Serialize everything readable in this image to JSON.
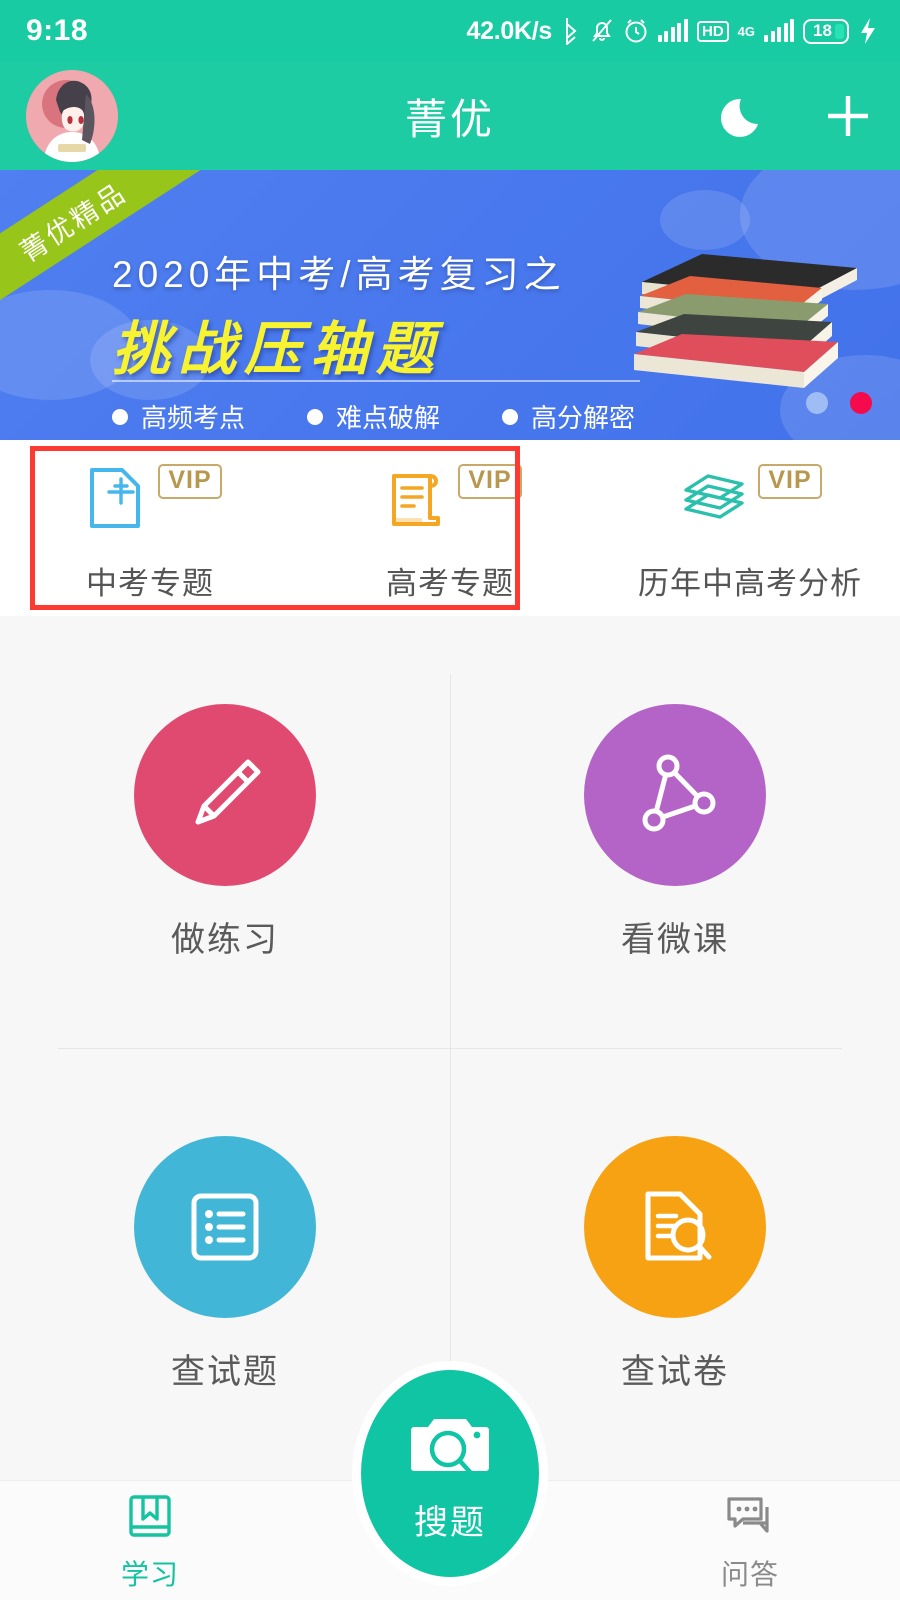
{
  "statusbar": {
    "time": "9:18",
    "network_speed": "42.0K/s",
    "hd_label": "HD",
    "network_type": "4G",
    "battery_level": "18",
    "icons": [
      "bluetooth-icon",
      "mute-icon",
      "alarm-icon",
      "signal-icon",
      "hd-icon",
      "4g-signal-icon",
      "battery-icon",
      "charging-icon"
    ]
  },
  "header": {
    "title": "菁优",
    "avatar_name": "user-avatar",
    "moon_icon": "moon-icon",
    "plus_icon": "plus-icon"
  },
  "banner": {
    "ribbon": "菁优精品",
    "line1": "2020年中考/高考复习之",
    "line2": "挑战压轴题",
    "features": [
      "高频考点",
      "难点破解",
      "高分解密"
    ],
    "illustration": "book-stack-illustration",
    "pager": {
      "total": 2,
      "active_index": 1
    },
    "colors": {
      "bg": "#4a79ee",
      "ribbon": "#98C51A",
      "title": "#F7F330",
      "dot_active": "#F50A4C",
      "dot_inactive": "#9FBCF5"
    }
  },
  "shortcuts": {
    "vip_badge": "VIP",
    "highlight_color": "#FC3A32",
    "items": [
      {
        "label": "中考专题",
        "icon": "document-zhongkao-icon",
        "icon_char": "中",
        "color": "#45B7EC",
        "vip": true,
        "highlighted": true
      },
      {
        "label": "高考专题",
        "icon": "scroll-gaokao-icon",
        "color": "#F5A623",
        "vip": true,
        "highlighted": true
      },
      {
        "label": "历年中高考分析",
        "icon": "stacked-books-icon",
        "color": "#2BC0AC",
        "vip": true,
        "highlighted": false
      }
    ]
  },
  "main_grid": {
    "items": [
      {
        "label": "做练习",
        "icon": "pencil-icon",
        "color": "#E04A70"
      },
      {
        "label": "看微课",
        "icon": "node-triangle-icon",
        "color": "#B463C6"
      },
      {
        "label": "查试题",
        "icon": "list-icon",
        "color": "#41B6D6"
      },
      {
        "label": "查试卷",
        "icon": "document-search-icon",
        "color": "#F6A213"
      }
    ]
  },
  "bottom_nav": {
    "items": [
      {
        "label": "学习",
        "icon": "book-icon",
        "active": true
      },
      {
        "label": "搜题",
        "icon": "camera-search-icon",
        "active": false
      },
      {
        "label": "问答",
        "icon": "chat-bubbles-icon",
        "active": false
      }
    ],
    "active_color": "#15C3A0",
    "idle_color": "#8A8A8A",
    "fab_color": "#0FC5A4"
  }
}
